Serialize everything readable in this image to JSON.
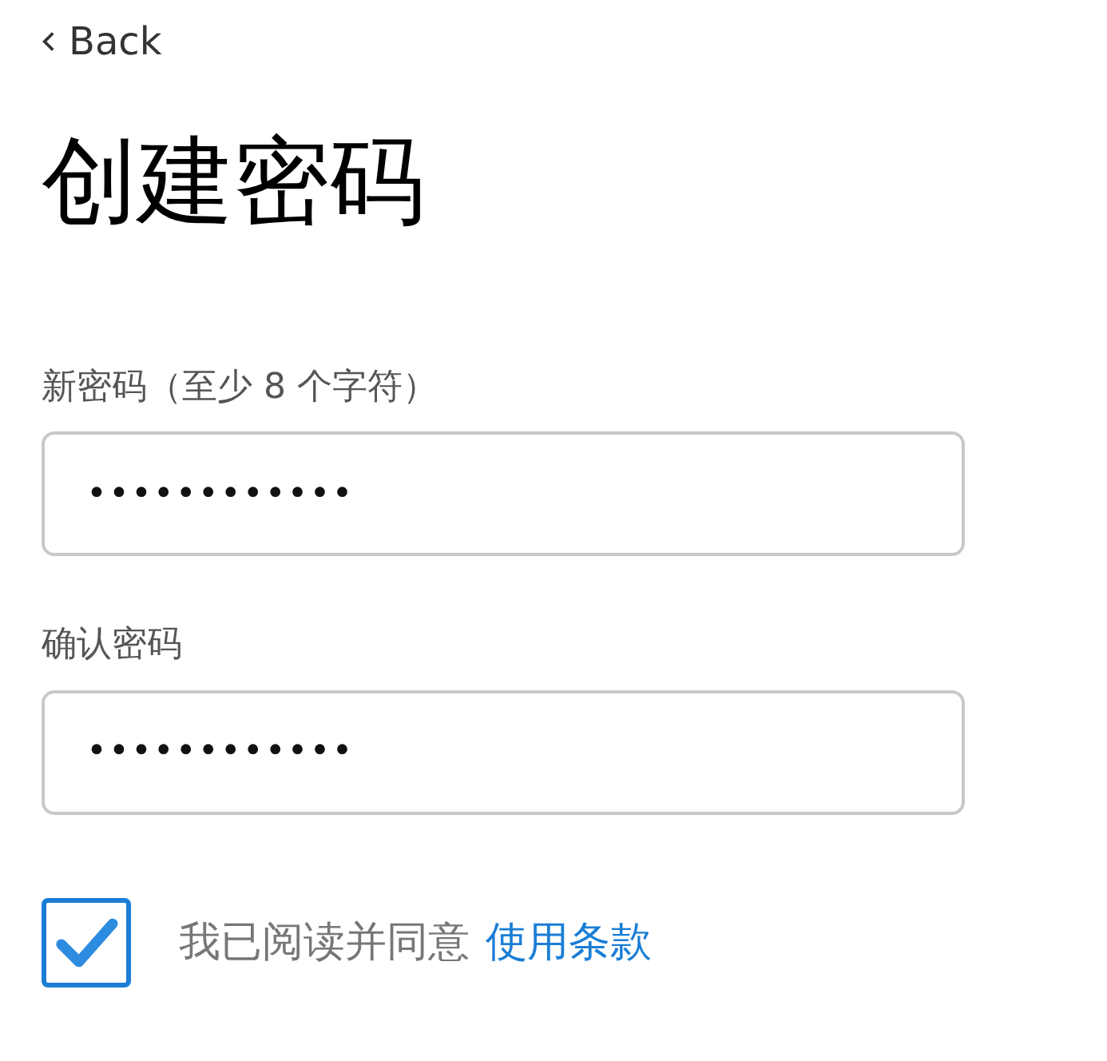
{
  "back": {
    "label": "Back"
  },
  "title": "创建密码",
  "fields": [
    {
      "label": "新密码（至少 8 个字符）",
      "value": "••••••••••••"
    },
    {
      "label": "确认密码",
      "value": "••••••••••••"
    }
  ],
  "agreement": {
    "checked": true,
    "text": "我已阅读并同意",
    "link": "使用条款"
  }
}
